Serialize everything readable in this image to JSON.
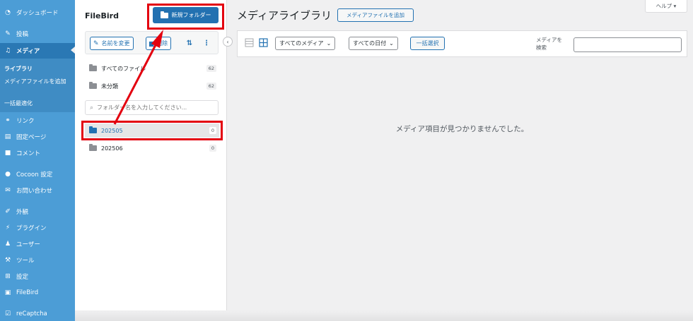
{
  "sidebar": {
    "items": [
      {
        "id": "dashboard",
        "label": "ダッシュボード",
        "icon": "dashboard-icon"
      },
      {
        "id": "posts",
        "label": "投稿",
        "icon": "pin-icon"
      },
      {
        "id": "media",
        "label": "メディア",
        "icon": "media-icon",
        "current": true
      },
      {
        "id": "links",
        "label": "リンク",
        "icon": "link-icon"
      },
      {
        "id": "pages",
        "label": "固定ページ",
        "icon": "page-icon"
      },
      {
        "id": "comments",
        "label": "コメント",
        "icon": "comment-icon"
      },
      {
        "id": "cocoon",
        "label": "Cocoon 設定",
        "icon": "circle-icon"
      },
      {
        "id": "contact",
        "label": "お問い合わせ",
        "icon": "mail-icon"
      },
      {
        "id": "appearance",
        "label": "外観",
        "icon": "brush-icon"
      },
      {
        "id": "plugins",
        "label": "プラグイン",
        "icon": "plug-icon"
      },
      {
        "id": "users",
        "label": "ユーザー",
        "icon": "user-icon"
      },
      {
        "id": "tools",
        "label": "ツール",
        "icon": "wrench-icon"
      },
      {
        "id": "settings",
        "label": "設定",
        "icon": "settings-icon"
      },
      {
        "id": "filebird",
        "label": "FileBird",
        "icon": "filebird-icon"
      },
      {
        "id": "recaptcha",
        "label": "reCaptcha",
        "icon": "check-icon"
      }
    ],
    "submenu": {
      "library": "ライブラリ",
      "add_new": "メディアファイルを追加",
      "optimize": "一括最適化"
    }
  },
  "filebird": {
    "title": "FileBird",
    "new_folder": "新規フォルダー",
    "rename": "名前を変更",
    "delete": "削除",
    "all_files": {
      "label": "すべてのファイル",
      "count": "62"
    },
    "uncategorized": {
      "label": "未分類",
      "count": "62"
    },
    "search_placeholder": "フォルダー名を入力してください...",
    "folders": [
      {
        "name": "202505",
        "count": "0",
        "selected": true
      },
      {
        "name": "202506",
        "count": "0",
        "selected": false
      }
    ]
  },
  "main": {
    "title": "メディアライブラリ",
    "add_media": "メディアファイルを追加",
    "help": "ヘルプ ▾",
    "filter_type": "すべてのメディア",
    "filter_date": "すべての日付",
    "bulk_select": "一括選択",
    "search_label": "メディアを検索",
    "search_value": "",
    "empty_message": "メディア項目が見つかりませんでした。"
  },
  "colors": {
    "sidebar": "#4c9dd6",
    "accent": "#2271b1",
    "annotation": "#e3000f"
  }
}
